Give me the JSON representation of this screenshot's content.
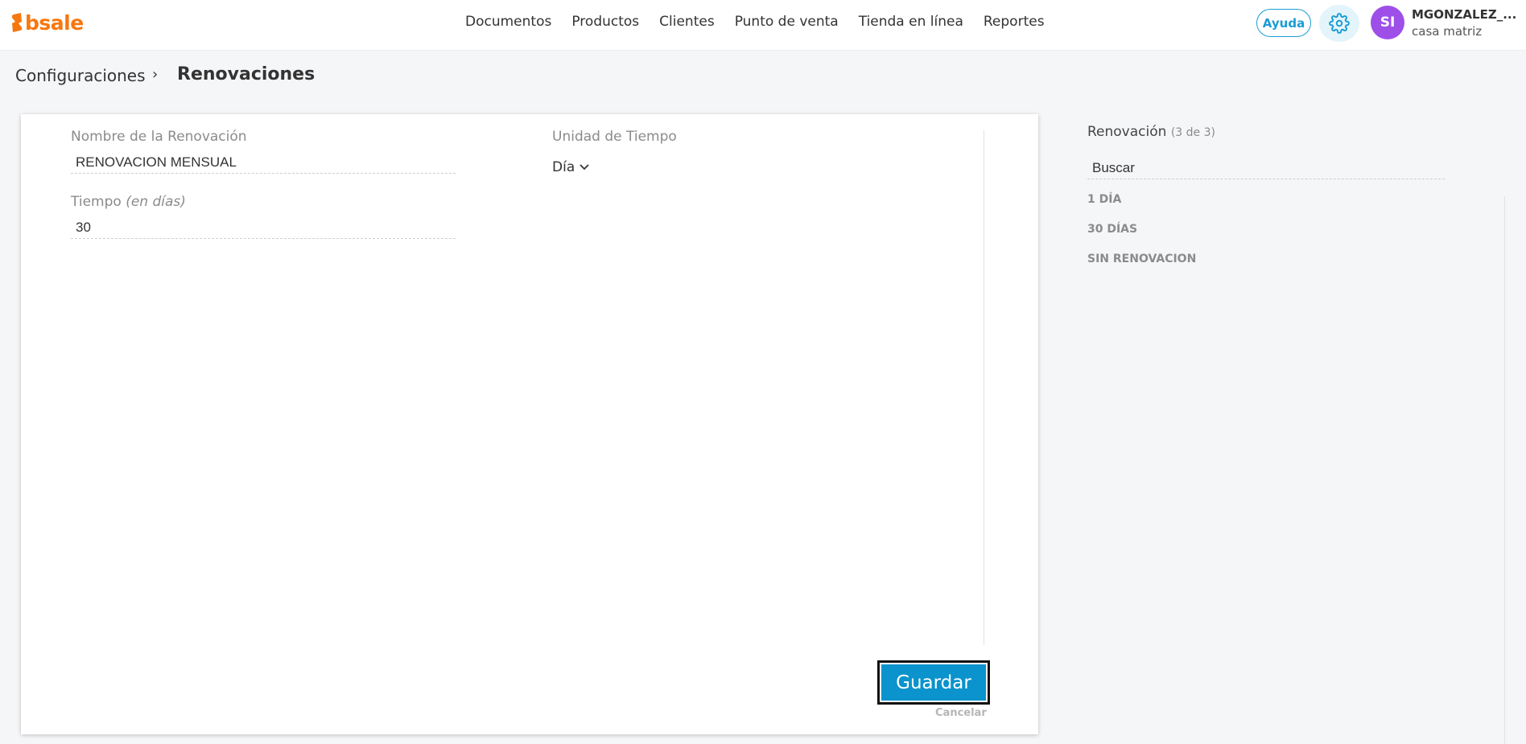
{
  "brand": {
    "name": "bsale",
    "color": "#f7770f",
    "icon": "bsale-logo-icon"
  },
  "nav": {
    "items": [
      {
        "label": "Documentos"
      },
      {
        "label": "Productos"
      },
      {
        "label": "Clientes"
      },
      {
        "label": "Punto de venta"
      },
      {
        "label": "Tienda en línea"
      },
      {
        "label": "Reportes"
      }
    ]
  },
  "header": {
    "help_label": "Ayuda",
    "settings_icon": "gear-icon",
    "avatar_initials": "SI",
    "user_name": "MGONZALEZ_...",
    "user_branch": "casa matriz"
  },
  "breadcrumb": {
    "parent": "Configuraciones",
    "separator": "›",
    "current": "Renovaciones"
  },
  "form": {
    "name_label": "Nombre de la Renovación",
    "name_value": "RENOVACION MENSUAL",
    "time_label": "Tiempo",
    "time_unit_hint": "(en días)",
    "time_value": "30",
    "unit_label": "Unidad de Tiempo",
    "unit_selected": "Día",
    "save_label": "Guardar",
    "cancel_label": "Cancelar"
  },
  "sidebar": {
    "title": "Renovación",
    "count": "(3 de 3)",
    "search_placeholder": "Buscar",
    "items": [
      {
        "label": "1 DÍA"
      },
      {
        "label": "30 DÍAS"
      },
      {
        "label": "SIN RENOVACION"
      }
    ]
  },
  "colors": {
    "accent": "#0a93cc",
    "link": "#1a9cd3",
    "avatar": "#9e4fe8",
    "brand": "#f7770f"
  }
}
